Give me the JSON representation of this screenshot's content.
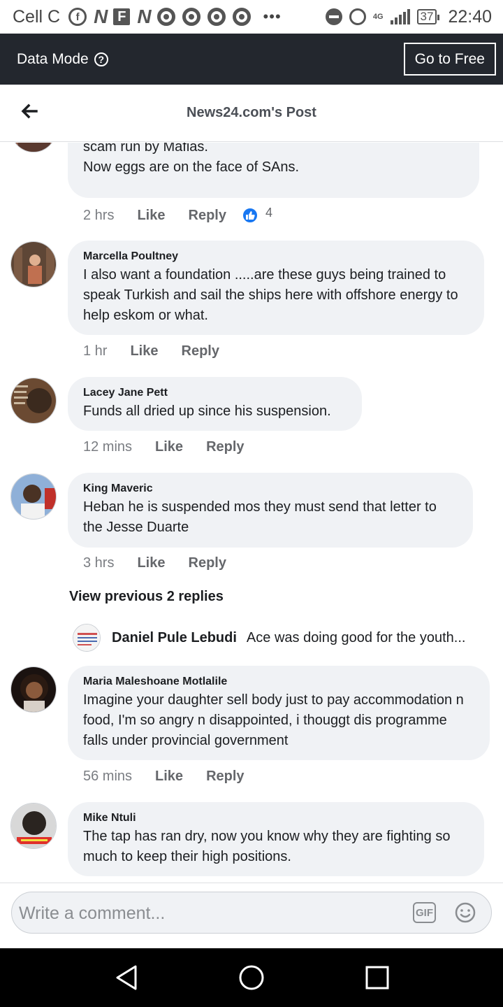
{
  "status_bar": {
    "carrier": "Cell C",
    "network": "4G",
    "battery": "37",
    "time": "22:40",
    "icons": [
      "facebook-icon",
      "n-app-icon",
      "f-app-icon",
      "n-app-icon",
      "chrome-icon",
      "chrome-icon",
      "chrome-icon",
      "chrome-icon",
      "more-dots-icon",
      "do-not-disturb-icon",
      "alarm-icon",
      "signal-icon",
      "battery-icon"
    ]
  },
  "data_mode": {
    "label": "Data Mode",
    "help_icon": "?",
    "go_free_label": "Go to Free"
  },
  "header": {
    "title": "News24.com's Post",
    "back_icon": "back-arrow-icon"
  },
  "comments": [
    {
      "name": "",
      "text_lines": [
        "scam run by Mafias.",
        "Now eggs are on the face of SAns."
      ],
      "time": "2 hrs",
      "like": "Like",
      "reply": "Reply",
      "reaction_count": "4"
    },
    {
      "name": "Marcella Poultney",
      "text": "I also want a foundation .....are these guys being trained to speak Turkish and sail the ships here with offshore energy to help eskom or what.",
      "time": "1 hr",
      "like": "Like",
      "reply": "Reply"
    },
    {
      "name": "Lacey Jane Pett",
      "text": "Funds all dried up since his suspension.",
      "time": "12 mins",
      "like": "Like",
      "reply": "Reply"
    },
    {
      "name": "King Maveric",
      "text": "Heban he is suspended mos they must send that letter to the Jesse Duarte",
      "time": "3 hrs",
      "like": "Like",
      "reply": "Reply"
    },
    {
      "name": "Maria Maleshoane Motlalile",
      "text": "Imagine your daughter sell body just to pay accommodation n food, I'm so angry n disappointed, i thouggt dis programme falls under provincial government",
      "time": "56 mins",
      "like": "Like",
      "reply": "Reply"
    },
    {
      "name": "Mike Ntuli",
      "text": "The tap has ran dry, now you know why they are fighting so much to keep their high positions."
    }
  ],
  "replies": {
    "view_previous": "View previous 2 replies",
    "latest": {
      "name": "Daniel Pule Lebudi",
      "text": "Ace was doing good for the youth..."
    }
  },
  "composer": {
    "placeholder": "Write a comment...",
    "gif_label": "GIF"
  },
  "colors": {
    "data_bar": "#23272e",
    "bubble": "#f0f2f5",
    "like_blue": "#1877f2",
    "nav_bar": "#000000"
  }
}
